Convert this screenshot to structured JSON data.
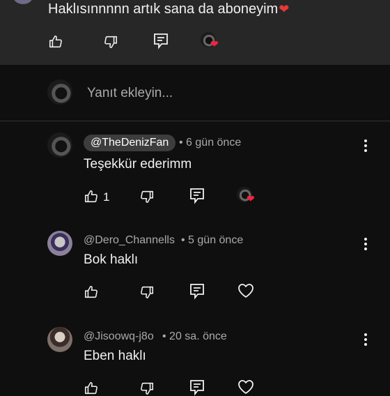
{
  "parent_comment": {
    "text": "Haklısınnnnn artık sana da aboneyim",
    "emoji": "❤"
  },
  "reply_input": {
    "placeholder": "Yanıt ekleyin..."
  },
  "replies": [
    {
      "handle": "@TheDenizFan",
      "time": "• 6 gün önce",
      "text": "Teşekkür ederimm",
      "likes": "1",
      "creator_heart": true
    },
    {
      "handle": "@Dero_Channells",
      "time": "• 5 gün önce",
      "text": "Bok haklı",
      "likes": "",
      "creator_heart": false
    },
    {
      "handle": "@Jisoowq-j8o",
      "time": "• 20 sa. önce",
      "text": "Eben haklı",
      "likes": "",
      "creator_heart": false
    }
  ],
  "icons": {
    "like": "thumbs-up-icon",
    "dislike": "thumbs-down-icon",
    "reply": "reply-icon",
    "heart": "heart-outline-icon",
    "menu": "more-vert-icon"
  },
  "colors": {
    "background": "#0f0f0f",
    "parent_background": "#272727",
    "secondary_text": "#aaaaaa",
    "creator_heart": "#ff1f3d",
    "handle_chip": "#3d3d3d"
  }
}
